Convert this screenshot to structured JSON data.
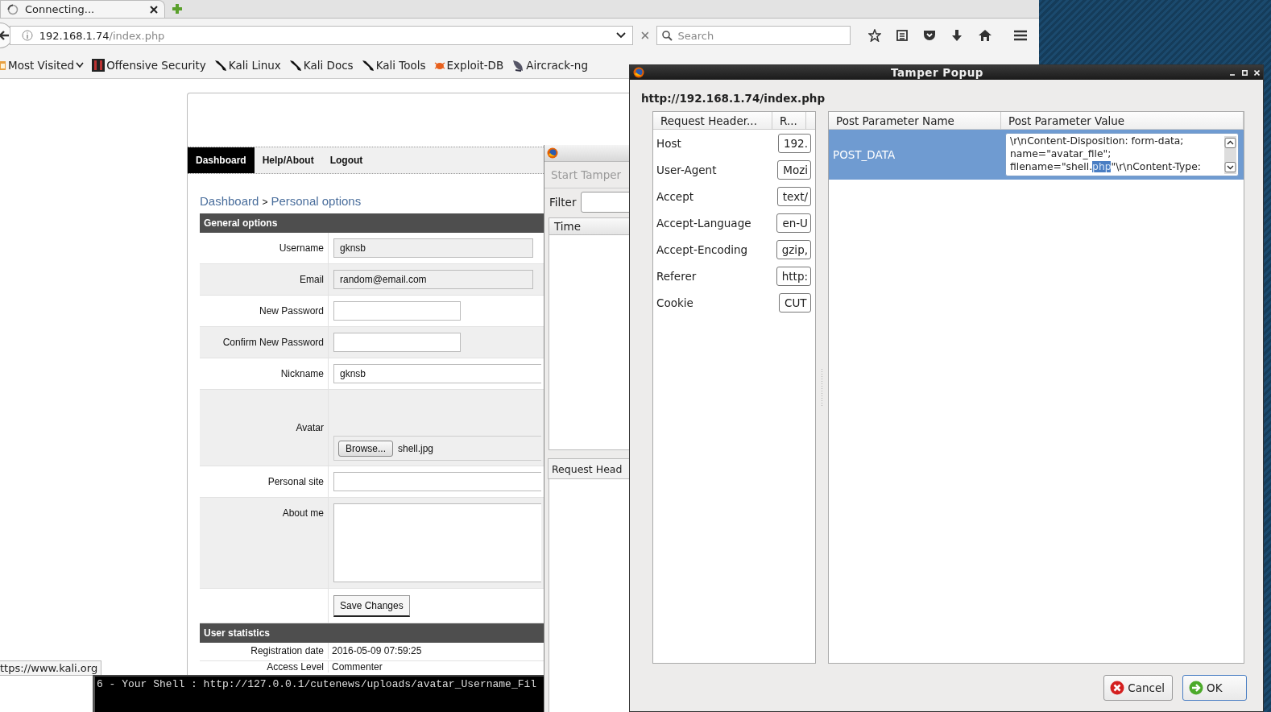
{
  "browser": {
    "tab": {
      "title": "Connecting...",
      "selected": true
    },
    "address": {
      "host": "192.168.1.74",
      "path": "/index.php"
    },
    "search": {
      "placeholder": "Search"
    },
    "bookmarks": [
      {
        "label": "Most Visited",
        "kind": "folder"
      },
      {
        "label": "Offensive Security",
        "kind": "offsec"
      },
      {
        "label": "Kali Linux",
        "kind": "kali"
      },
      {
        "label": "Kali Docs",
        "kind": "kali"
      },
      {
        "label": "Kali Tools",
        "kind": "kali"
      },
      {
        "label": "Exploit-DB",
        "kind": "bug"
      },
      {
        "label": "Aircrack-ng",
        "kind": "dish"
      }
    ],
    "status_url": "ttps://www.kali.org"
  },
  "page": {
    "nav": [
      {
        "label": "Dashboard",
        "selected": true
      },
      {
        "label": "Help/About",
        "selected": false
      },
      {
        "label": "Logout",
        "selected": false
      }
    ],
    "breadcrumb": {
      "items": [
        "Dashboard",
        "Personal options"
      ],
      "separator": ">"
    },
    "general_options": {
      "title": "General options",
      "rows": [
        {
          "kind": "readonly",
          "label": "Username",
          "value": "gknsb"
        },
        {
          "kind": "readonly",
          "label": "Email",
          "value": "random@email.com"
        },
        {
          "kind": "short",
          "label": "New Password"
        },
        {
          "kind": "short",
          "label": "Confirm New Password"
        },
        {
          "kind": "text",
          "label": "Nickname",
          "value": "gknsb"
        },
        {
          "kind": "file",
          "label": "Avatar",
          "button": "Browse...",
          "value": "shell.jpg"
        },
        {
          "kind": "text",
          "label": "Personal site"
        },
        {
          "kind": "textarea",
          "label": "About me"
        },
        {
          "kind": "submit",
          "button": "Save Changes"
        }
      ]
    },
    "user_statistics": {
      "title": "User statistics",
      "rows": [
        {
          "label": "Registration date",
          "value": "2016-05-09 07:59:25"
        },
        {
          "label": "Access Level",
          "value": "Commenter"
        }
      ]
    }
  },
  "tamper_data": {
    "start_button": {
      "label": "Start Tamper",
      "disabled": true
    },
    "filter_label": "Filter",
    "columns": [
      "Time"
    ],
    "tab": "Request Head"
  },
  "tamper_popup": {
    "title": "Tamper Popup",
    "url": "http://192.168.1.74/index.php",
    "headers": {
      "columns": [
        "Request Header...",
        "R..."
      ],
      "rows": [
        {
          "name": "Host",
          "value": "192."
        },
        {
          "name": "User-Agent",
          "value": "Mozi"
        },
        {
          "name": "Accept",
          "value": "text/"
        },
        {
          "name": "Accept-Language",
          "value": "en-U"
        },
        {
          "name": "Accept-Encoding",
          "value": "gzip,"
        },
        {
          "name": "Referer",
          "value": "http:"
        },
        {
          "name": "Cookie",
          "value": "CUT"
        }
      ]
    },
    "post": {
      "columns": [
        "Post Parameter Name",
        "Post Parameter Value"
      ],
      "rows": [
        {
          "name": "POST_DATA",
          "selected": true,
          "value_lines": [
            [
              {
                "text": "\\r\\nContent-Disposition: form-data;",
                "selected": false
              }
            ],
            [
              {
                "text": "name=\"avatar_file\";",
                "selected": false
              }
            ],
            [
              {
                "text": "filename=\"shell.",
                "selected": false
              },
              {
                "text": "php",
                "selected": true
              },
              {
                "text": "\"\\r\\nContent-Type:",
                "selected": false
              }
            ]
          ]
        }
      ]
    },
    "buttons": [
      {
        "label": "Cancel",
        "kind": "cancel",
        "default": false
      },
      {
        "label": "OK",
        "kind": "ok",
        "default": true
      }
    ]
  },
  "terminal": {
    "lines": [
      "6 - Your Shell : http://127.0.0.1/cutenews/uploads/avatar_Username_Fil"
    ]
  }
}
